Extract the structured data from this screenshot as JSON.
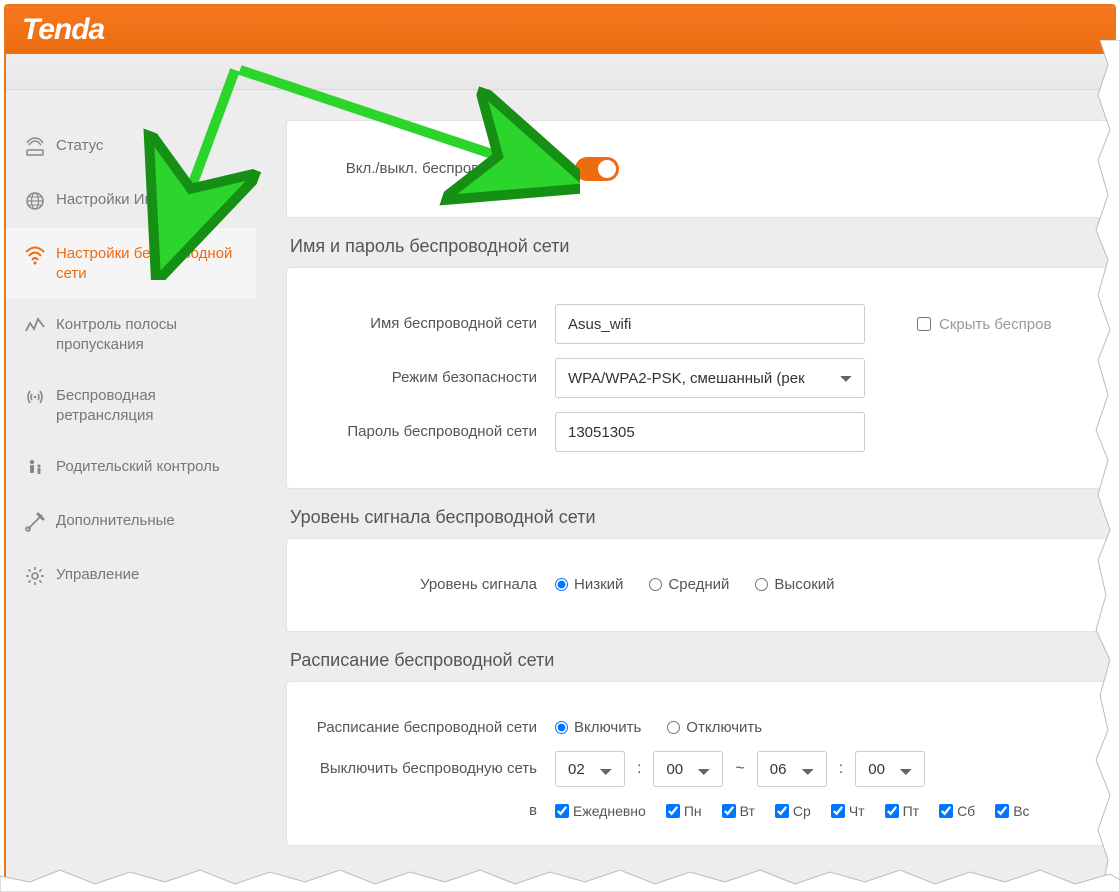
{
  "brand": "Tenda",
  "sidebar": {
    "items": [
      {
        "label": "Статус",
        "icon": "status-icon"
      },
      {
        "label": "Настройки Интернета",
        "icon": "globe-icon"
      },
      {
        "label": "Настройки беспроводной сети",
        "icon": "wifi-icon"
      },
      {
        "label": "Контроль полосы пропускания",
        "icon": "bandwidth-icon"
      },
      {
        "label": "Беспроводная ретрансляция",
        "icon": "repeat-icon"
      },
      {
        "label": "Родительский контроль",
        "icon": "parental-icon"
      },
      {
        "label": "Дополнительные",
        "icon": "tools-icon"
      },
      {
        "label": "Управление",
        "icon": "gear-icon"
      }
    ],
    "activeIndex": 2
  },
  "toggle": {
    "label": "Вкл./выкл. беспроводную сеть",
    "on": true
  },
  "sections": {
    "name_pw": {
      "title": "Имя и пароль беспроводной сети",
      "ssid_label": "Имя беспроводной сети",
      "ssid_value": "Asus_wifi",
      "hide_label": "Скрыть беспров",
      "mode_label": "Режим безопасности",
      "mode_value": "WPA/WPA2-PSK, смешанный (рек",
      "pw_label": "Пароль беспроводной сети",
      "pw_value": "13051305"
    },
    "signal": {
      "title": "Уровень сигнала беспроводной сети",
      "label": "Уровень сигнала",
      "options": {
        "low": "Низкий",
        "med": "Средний",
        "high": "Высокий"
      },
      "selected": "low"
    },
    "schedule": {
      "title": "Расписание беспроводной сети",
      "enable_label": "Расписание беспроводной сети",
      "enable_on": "Включить",
      "enable_off": "Отключить",
      "enabled": true,
      "off_label": "Выключить беспроводную сеть",
      "time": {
        "h1": "02",
        "m1": "00",
        "h2": "06",
        "m2": "00",
        "sep": "~"
      },
      "days_prefix": "в",
      "days": [
        "Ежедневно",
        "Пн",
        "Вт",
        "Ср",
        "Чт",
        "Пт",
        "Сб",
        "Вс"
      ]
    }
  }
}
